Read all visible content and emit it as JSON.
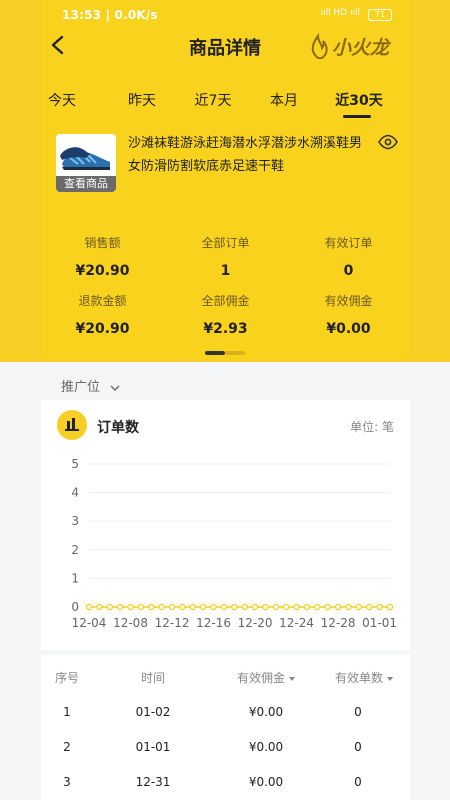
{
  "status_bar": {
    "time": "13:53 | 0.0K/s",
    "indicators": "ııll HD ııll",
    "battery": "71"
  },
  "header": {
    "title": "商品详情",
    "brand": "小火龙",
    "back_icon": "chevron-left-icon"
  },
  "tabs": [
    {
      "label": "今天",
      "selected": false
    },
    {
      "label": "昨天",
      "selected": false
    },
    {
      "label": "近7天",
      "selected": false
    },
    {
      "label": "本月",
      "selected": false
    },
    {
      "label": "近30天",
      "selected": true
    }
  ],
  "product": {
    "name": "沙滩袜鞋游泳赶海潜水浮潜涉水溯溪鞋男女防滑防割软底赤足速干鞋",
    "thumb_label": "查看商品",
    "visibility_icon": "eye-icon"
  },
  "stats": [
    {
      "label": "销售额",
      "value": "¥20.90"
    },
    {
      "label": "全部订单",
      "value": "1"
    },
    {
      "label": "有效订单",
      "value": "0"
    },
    {
      "label": "退款金额",
      "value": "¥20.90"
    },
    {
      "label": "全部佣金",
      "value": "¥2.93"
    },
    {
      "label": "有效佣金",
      "value": "¥0.00"
    }
  ],
  "filter": {
    "label": "推广位"
  },
  "chart_section": {
    "title": "订单数",
    "unit": "单位: 笔"
  },
  "chart_data": {
    "type": "line",
    "title": "订单数",
    "xlabel": "",
    "ylabel": "",
    "ylim": [
      0,
      5
    ],
    "yticks": [
      0,
      1,
      2,
      3,
      4,
      5
    ],
    "x_tick_labels": [
      "12-04",
      "12-08",
      "12-12",
      "12-16",
      "12-20",
      "12-24",
      "12-28",
      "01-01"
    ],
    "x": [
      "12-04",
      "12-05",
      "12-06",
      "12-07",
      "12-08",
      "12-09",
      "12-10",
      "12-11",
      "12-12",
      "12-13",
      "12-14",
      "12-15",
      "12-16",
      "12-17",
      "12-18",
      "12-19",
      "12-20",
      "12-21",
      "12-22",
      "12-23",
      "12-24",
      "12-25",
      "12-26",
      "12-27",
      "12-28",
      "12-29",
      "12-30",
      "12-31",
      "01-01",
      "01-02"
    ],
    "series": [
      {
        "values": [
          0,
          0,
          0,
          0,
          0,
          0,
          0,
          0,
          0,
          0,
          0,
          0,
          0,
          0,
          0,
          0,
          0,
          0,
          0,
          0,
          0,
          0,
          0,
          0,
          0,
          0,
          0,
          0,
          0,
          0
        ],
        "color": "#f7ce23"
      }
    ],
    "grid": true
  },
  "table": {
    "headers": [
      "序号",
      "时间",
      "有效佣金",
      "有效单数"
    ],
    "rows": [
      [
        "1",
        "01-02",
        "¥0.00",
        "0"
      ],
      [
        "2",
        "01-01",
        "¥0.00",
        "0"
      ],
      [
        "3",
        "12-31",
        "¥0.00",
        "0"
      ]
    ]
  },
  "colors": {
    "accent": "#f7ce23",
    "text": "#222222",
    "muted": "#888888"
  }
}
